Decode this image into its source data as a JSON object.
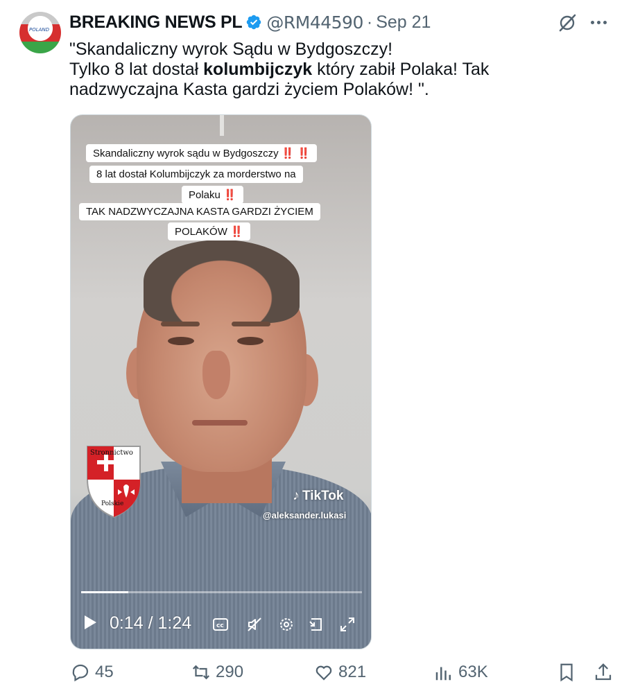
{
  "author": {
    "display_name": "BREAKING NEWS PL",
    "handle": "@RM44590",
    "separator": "·",
    "date": "Sep 21",
    "avatar_text": "POLAND"
  },
  "tweet": {
    "line1": "\"Skandaliczny wyrok Sądu w Bydgoszczy!",
    "line2_pre": "Tylko 8 lat dostał ",
    "line2_bold": "kolumbijczyk",
    "line2_post": " który zabił Polaka! Tak",
    "line3": "nadzwyczajna Kasta gardzi życiem Polaków! \"."
  },
  "video": {
    "caption_lines": [
      "Skandaliczny wyrok sądu w Bydgoszczy",
      "8 lat dostał Kolumbijczyk za morderstwo na",
      "Polaku",
      "TAK NADZWYCZAJNA KASTA GARDZI ŻYCIEM",
      "POLAKÓW"
    ],
    "bang": "‼️",
    "bang_double": "‼️ ‼️",
    "shield_top_text": "Stronnictwo",
    "shield_bottom_text": "Polskie",
    "tiktok_brand": "TikTok",
    "tiktok_handle": "@aleksander.lukasi",
    "current_time": "0:14",
    "duration": "1:24",
    "time_display": "0:14 / 1:24",
    "progress_fraction": 0.167
  },
  "actions": {
    "replies": "45",
    "reposts": "290",
    "likes": "821",
    "views": "63K"
  },
  "colors": {
    "text_primary": "#0f1419",
    "text_secondary": "#536471",
    "verified_blue": "#1d9bf0",
    "border": "#cfd9de"
  },
  "icons": [
    "verified-badge-icon",
    "grok-icon",
    "more-icon",
    "play-icon",
    "captions-icon",
    "mute-icon",
    "settings-icon",
    "pip-icon",
    "fullscreen-icon",
    "reply-icon",
    "repost-icon",
    "like-icon",
    "views-icon",
    "bookmark-icon",
    "share-icon"
  ]
}
